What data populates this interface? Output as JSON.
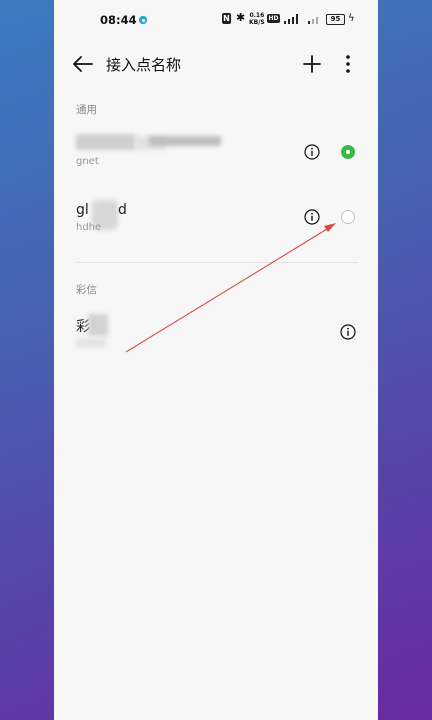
{
  "status_bar": {
    "time": "08:44",
    "n_icon": "N",
    "bluetooth": "✱",
    "speed_value": "0.16",
    "speed_unit": "KB/S",
    "hd_badge": "HD",
    "battery": "95",
    "charging": "ϟ"
  },
  "toolbar": {
    "title": "接入点名称",
    "back_icon": "arrow-left-icon",
    "add_icon": "plus-icon",
    "more_icon": "more-vertical-icon"
  },
  "sections": [
    {
      "label": "通用",
      "items": [
        {
          "name_visible": "",
          "name_suffix": "",
          "subtitle": "gnet",
          "selected": true
        },
        {
          "name_visible": "gl",
          "name_suffix": "d",
          "subtitle": "hdhe",
          "selected": false
        }
      ]
    },
    {
      "label": "彩信",
      "items": [
        {
          "name_visible": "彩",
          "name_suffix": "",
          "subtitle": "",
          "selected": null
        }
      ]
    }
  ],
  "colors": {
    "selected_radio": "#3db74a",
    "annotation_arrow": "#d9473f",
    "panel_background": "#f7f7f7"
  }
}
